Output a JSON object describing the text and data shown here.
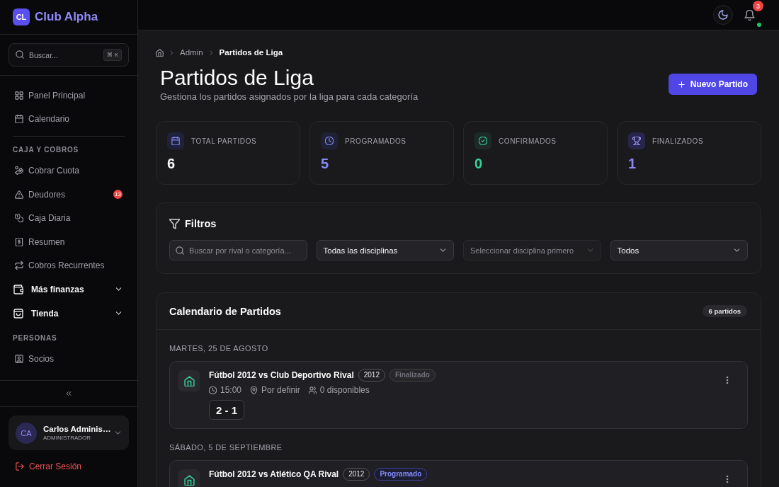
{
  "sidebar": {
    "logo": {
      "initials": "CL",
      "name": "Club Alpha"
    },
    "search": {
      "placeholder": "Buscar...",
      "shortcut": "⌘ K"
    },
    "nav": [
      {
        "items": [
          {
            "kind": "link",
            "label": "Panel Principal",
            "selected": false
          },
          {
            "kind": "link",
            "label": "Calendario",
            "selected": false
          }
        ]
      },
      {
        "heading": "CAJA Y COBROS",
        "items": [
          {
            "kind": "link",
            "label": "Cobrar Cuota",
            "selected": false
          },
          {
            "kind": "link",
            "label": "Deudores",
            "selected": false,
            "badge": "13"
          },
          {
            "kind": "link",
            "label": "Caja Diaria",
            "selected": false
          },
          {
            "kind": "link",
            "label": "Resumen",
            "selected": false
          },
          {
            "kind": "link",
            "label": "Cobros Recurrentes",
            "selected": false
          },
          {
            "kind": "menu",
            "label": "Más finanzas",
            "selected": false,
            "expanded": false
          },
          {
            "kind": "menu",
            "label": "Tienda",
            "selected": false,
            "expanded": false
          }
        ]
      },
      {
        "heading": "PERSONAS",
        "items": [
          {
            "kind": "link",
            "label": "Socios",
            "selected": false
          }
        ]
      }
    ],
    "user": {
      "initials": "CA",
      "name": "Carlos Adminis…",
      "role": "ADMINISTRADOR"
    },
    "logout": "Cerrar Sesión"
  },
  "topbar": {
    "notifications": {
      "count": "3",
      "status_online": true
    }
  },
  "breadcrumb": [
    {
      "label": "Admin",
      "current": false
    },
    {
      "label": "Partidos de Liga",
      "current": true
    }
  ],
  "page_header": {
    "title": "Partidos de Liga",
    "subtitle": "Gestiona los partidos asignados por la liga para cada categoría",
    "action": "Nuevo Partido"
  },
  "stats": [
    {
      "label": "TOTAL PARTIDOS",
      "value": "6",
      "color": "#fafafa"
    },
    {
      "label": "PROGRAMADOS",
      "value": "5",
      "color": "#818cf8"
    },
    {
      "label": "CONFIRMADOS",
      "value": "0",
      "color": "#34d399"
    },
    {
      "label": "FINALIZADOS",
      "value": "1",
      "color": "#8b85f7"
    }
  ],
  "filters": {
    "title": "Filtros",
    "fields": [
      {
        "kind": "search",
        "placeholder": "Buscar por rival o categoría..."
      },
      {
        "kind": "select",
        "value": "Todas las disciplinas",
        "disabled": false
      },
      {
        "kind": "select",
        "placeholder": "Seleccionar disciplina primero",
        "disabled": true
      },
      {
        "kind": "select",
        "value": "Todos",
        "disabled": false
      }
    ]
  },
  "calendar": {
    "title": "Calendario de Partidos",
    "count": "6 partidos",
    "days": [
      {
        "date": "MARTES, 25 DE AGOSTO",
        "matches": [
          {
            "title": "Fútbol 2012 vs Club Deportivo Rival",
            "category": "2012",
            "status": {
              "kind": "finished",
              "label": "Finalizado"
            },
            "time": "15:00",
            "venue": "Por definir",
            "available": "0 disponibles",
            "score": "2 - 1"
          }
        ]
      },
      {
        "date": "SÁBADO, 5 DE SEPTIEMBRE",
        "matches": [
          {
            "title": "Fútbol 2012 vs Atlético QA Rival",
            "category": "2012",
            "status": {
              "kind": "scheduled",
              "label": "Programado"
            }
          }
        ]
      }
    ]
  }
}
